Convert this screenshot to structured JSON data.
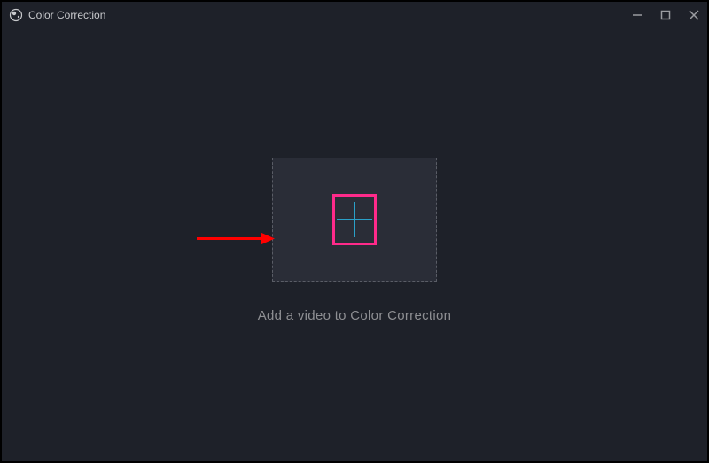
{
  "window": {
    "title": "Color Correction"
  },
  "main": {
    "hint": "Add a video to Color Correction"
  },
  "colors": {
    "accent_blue": "#2aa0c8",
    "highlight_pink": "#ff2a8a",
    "arrow_red": "#ff0000"
  }
}
